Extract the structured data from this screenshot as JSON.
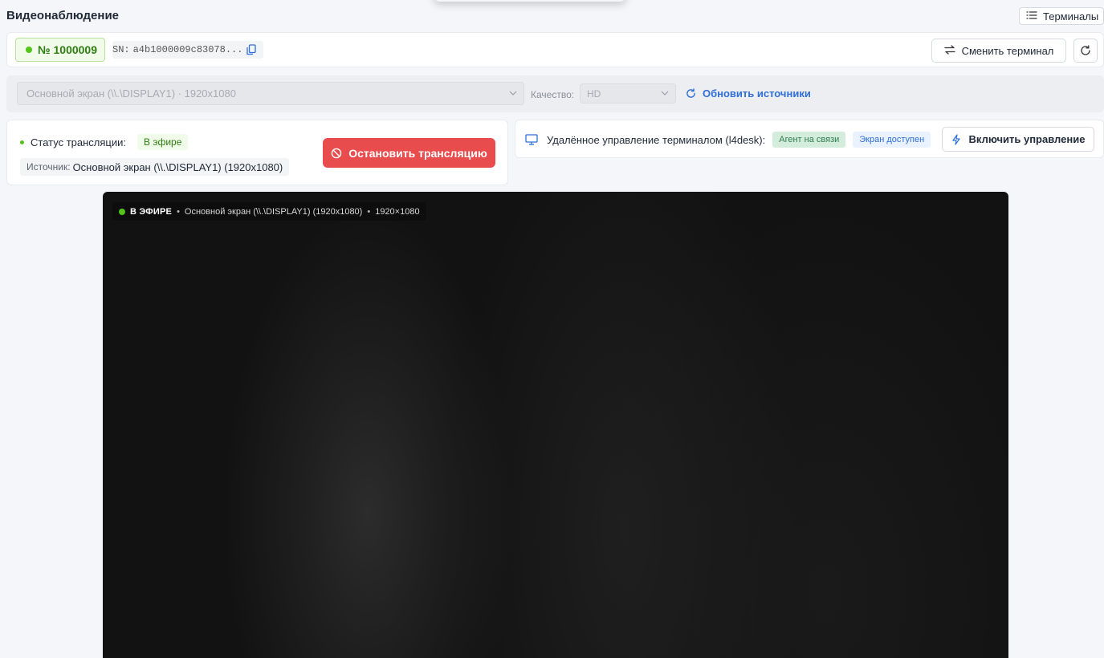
{
  "header": {
    "title": "Видеонаблюдение",
    "terminals_button": "Терминалы"
  },
  "terminal": {
    "number": "№ 1000009",
    "sn_label": "SN:",
    "sn_value": "a4b1000009c83078...",
    "switch_button": "Сменить терминал"
  },
  "sources": {
    "selected_source": "Основной экран (\\\\.\\DISPLAY1) · 1920x1080",
    "quality_label": "Качество:",
    "quality_value": "HD",
    "update_button": "Обновить источники"
  },
  "stream": {
    "status_label": "Статус трансляции:",
    "status_value": "В эфире",
    "source_label": "Источник:",
    "source_value": "Основной экран (\\\\.\\DISPLAY1) (1920x1080)",
    "stop_button": "Остановить трансляцию"
  },
  "remote": {
    "title": "Удалённое управление терминалом (l4desk):",
    "agent_badge": "Агент на связи",
    "screen_badge": "Экран доступен",
    "enable_button": "Включить управление"
  },
  "video": {
    "live_label": "В ЭФИРЕ",
    "source_text": "Основной экран (\\\\.\\DISPLAY1) (1920x1080)",
    "resolution": "1920×1080"
  },
  "colors": {
    "accent": "#2f6fd6",
    "live_green": "#52c41a",
    "stop_red": "#e84c4c"
  }
}
